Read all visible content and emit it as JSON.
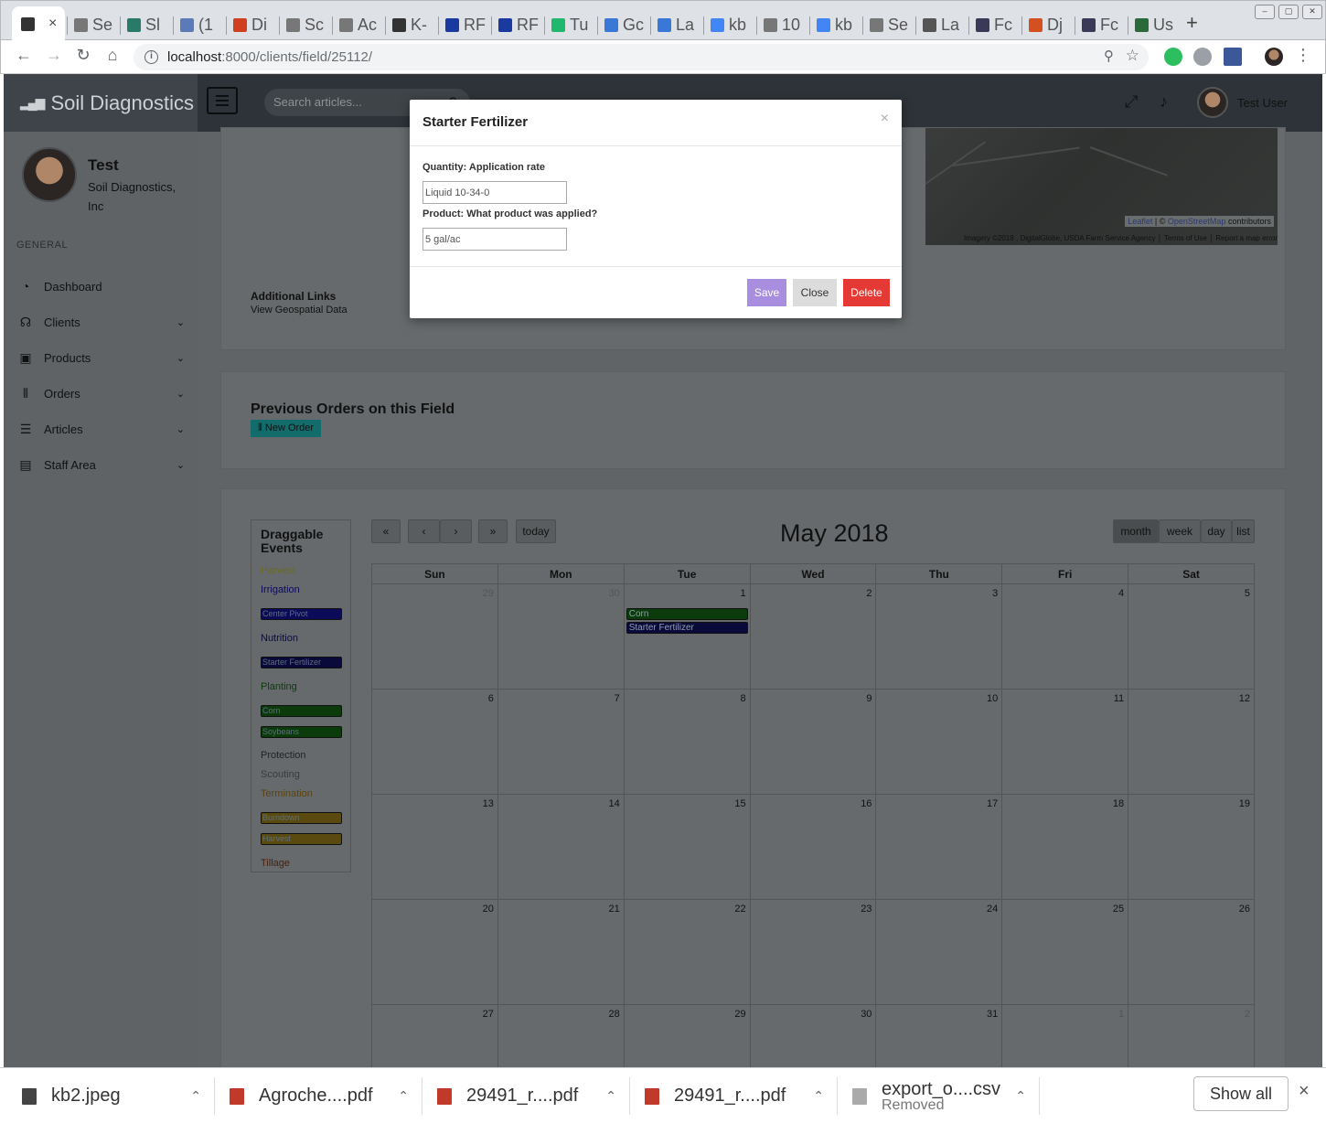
{
  "browser": {
    "active_tab_close": "×",
    "tabs": [
      {
        "label": "Se",
        "color": "#777"
      },
      {
        "label": "Sl",
        "color": "#2a7a6a"
      },
      {
        "label": "(1",
        "color": "#5a7ab8"
      },
      {
        "label": "Di",
        "color": "#d04020"
      },
      {
        "label": "Sc",
        "color": "#777"
      },
      {
        "label": "Ac",
        "color": "#777"
      },
      {
        "label": "K-",
        "color": "#333"
      },
      {
        "label": "RF",
        "color": "#1a3aa0"
      },
      {
        "label": "RF",
        "color": "#1a3aa0"
      },
      {
        "label": "Tu",
        "color": "#1fb86c"
      },
      {
        "label": "Gc",
        "color": "#3a78d8"
      },
      {
        "label": "La",
        "color": "#3a78d8"
      },
      {
        "label": "kb",
        "color": "#4285f4"
      },
      {
        "label": "10",
        "color": "#777"
      },
      {
        "label": "kb",
        "color": "#4285f4"
      },
      {
        "label": "Se",
        "color": "#777"
      },
      {
        "label": "La",
        "color": "#555"
      },
      {
        "label": "Fc",
        "color": "#3a3a58"
      },
      {
        "label": "Dj",
        "color": "#d45020"
      },
      {
        "label": "Fc",
        "color": "#3a3a58"
      },
      {
        "label": "Us",
        "color": "#2a6a3a"
      }
    ],
    "new_tab": "+",
    "url_host": "localhost",
    "url_path": ":8000/clients/field/25112/"
  },
  "app": {
    "brand": "Soil Diagnostics",
    "search_placeholder": "Search articles...",
    "user_name": "Test User",
    "profile": {
      "name": "Test",
      "org": "Soil Diagnostics, Inc"
    },
    "section_label": "GENERAL",
    "menu": [
      {
        "label": "Dashboard",
        "icon": "dashboard-icon",
        "expandable": false
      },
      {
        "label": "Clients",
        "icon": "headset-icon",
        "expandable": true
      },
      {
        "label": "Products",
        "icon": "box-icon",
        "expandable": true
      },
      {
        "label": "Orders",
        "icon": "chart-icon",
        "expandable": true
      },
      {
        "label": "Articles",
        "icon": "list-icon",
        "expandable": true
      },
      {
        "label": "Staff Area",
        "icon": "briefcase-icon",
        "expandable": true
      }
    ]
  },
  "map": {
    "attribution_leaflet": "Leaflet",
    "attribution_osm": "OpenStreetMap",
    "attribution_contributors": "contributors",
    "imagery": "Imagery ©2018 , DigitalGlobe, USDA Farm Service Agency",
    "terms": "Terms of Use",
    "report": "Report a map error"
  },
  "field": {
    "additional_links_title": "Additional Links",
    "geospatial_link": "View Geospatial Data",
    "previous_orders_title": "Previous Orders on this Field",
    "new_order_button": "New Order"
  },
  "calendar": {
    "title": "May 2018",
    "nav": {
      "prev_year": "«",
      "prev": "‹",
      "next": "›",
      "next_year": "»",
      "today": "today"
    },
    "views": [
      "month",
      "week",
      "day",
      "list"
    ],
    "active_view": "month",
    "weekdays": [
      "Sun",
      "Mon",
      "Tue",
      "Wed",
      "Thu",
      "Fri",
      "Sat"
    ],
    "weeks": [
      [
        {
          "d": "29",
          "o": true
        },
        {
          "d": "30",
          "o": true
        },
        {
          "d": "1"
        },
        {
          "d": "2"
        },
        {
          "d": "3"
        },
        {
          "d": "4"
        },
        {
          "d": "5"
        }
      ],
      [
        {
          "d": "6"
        },
        {
          "d": "7"
        },
        {
          "d": "8"
        },
        {
          "d": "9"
        },
        {
          "d": "10"
        },
        {
          "d": "11"
        },
        {
          "d": "12"
        }
      ],
      [
        {
          "d": "13"
        },
        {
          "d": "14"
        },
        {
          "d": "15"
        },
        {
          "d": "16"
        },
        {
          "d": "17"
        },
        {
          "d": "18"
        },
        {
          "d": "19"
        }
      ],
      [
        {
          "d": "20"
        },
        {
          "d": "21"
        },
        {
          "d": "22"
        },
        {
          "d": "23"
        },
        {
          "d": "24"
        },
        {
          "d": "25"
        },
        {
          "d": "26"
        }
      ],
      [
        {
          "d": "27"
        },
        {
          "d": "28"
        },
        {
          "d": "29"
        },
        {
          "d": "30"
        },
        {
          "d": "31"
        },
        {
          "d": "1",
          "o": true
        },
        {
          "d": "2",
          "o": true
        }
      ]
    ],
    "events": [
      {
        "week": 0,
        "day": 2,
        "label": "Corn",
        "color": "#0b3a0b"
      },
      {
        "week": 0,
        "day": 2,
        "label": "Starter Fertilizer",
        "color": "#0a0a3a"
      }
    ],
    "draggable": {
      "title": "Draggable Events",
      "items": [
        {
          "type": "cat",
          "label": "Harvest",
          "color": "#6b6a20"
        },
        {
          "type": "cat",
          "label": "Irrigation",
          "color": "#0a0a5a"
        },
        {
          "type": "chip",
          "label": "Center Pivot",
          "color": "#0b0b5a"
        },
        {
          "type": "cat",
          "label": "Nutrition",
          "color": "#0a0a3a"
        },
        {
          "type": "chip",
          "label": "Starter Fertilizer",
          "color": "#0a0a3a"
        },
        {
          "type": "cat",
          "label": "Planting",
          "color": "#0b3a0b"
        },
        {
          "type": "chip",
          "label": "Corn",
          "color": "#0b3a0b"
        },
        {
          "type": "chip",
          "label": "Soybeans",
          "color": "#0b3a0b"
        },
        {
          "type": "cat",
          "label": "Protection",
          "color": "#222"
        },
        {
          "type": "cat",
          "label": "Scouting",
          "color": "#3a3a3a"
        },
        {
          "type": "cat",
          "label": "Termination",
          "color": "#5a4210"
        },
        {
          "type": "chip",
          "label": "Burndown",
          "color": "#5a4a10"
        },
        {
          "type": "chip",
          "label": "Harvest",
          "color": "#5a4a10"
        },
        {
          "type": "cat",
          "label": "Tillage",
          "color": "#4a1f0a"
        }
      ]
    }
  },
  "modal": {
    "title": "Starter Fertilizer",
    "close": "×",
    "qty_label": "Quantity: Application rate",
    "qty_value": "Liquid 10-34-0",
    "product_label": "Product: What product was applied?",
    "product_value": "5 gal/ac",
    "save": "Save",
    "close_button": "Close",
    "delete": "Delete"
  },
  "downloads": [
    {
      "name": "kb2.jpeg",
      "status": "",
      "icon": "image-file-icon",
      "color": "#444"
    },
    {
      "name": "Agroche....pdf",
      "status": "",
      "icon": "pdf-file-icon",
      "color": "#c0392b"
    },
    {
      "name": "29491_r....pdf",
      "status": "",
      "icon": "pdf-file-icon",
      "color": "#c0392b"
    },
    {
      "name": "29491_r....pdf",
      "status": "",
      "icon": "pdf-file-icon",
      "color": "#c0392b"
    },
    {
      "name": "export_o....csv",
      "status": "Removed",
      "icon": "document-file-icon",
      "color": "#aaa"
    }
  ],
  "show_all": "Show all",
  "close_downloads": "×"
}
